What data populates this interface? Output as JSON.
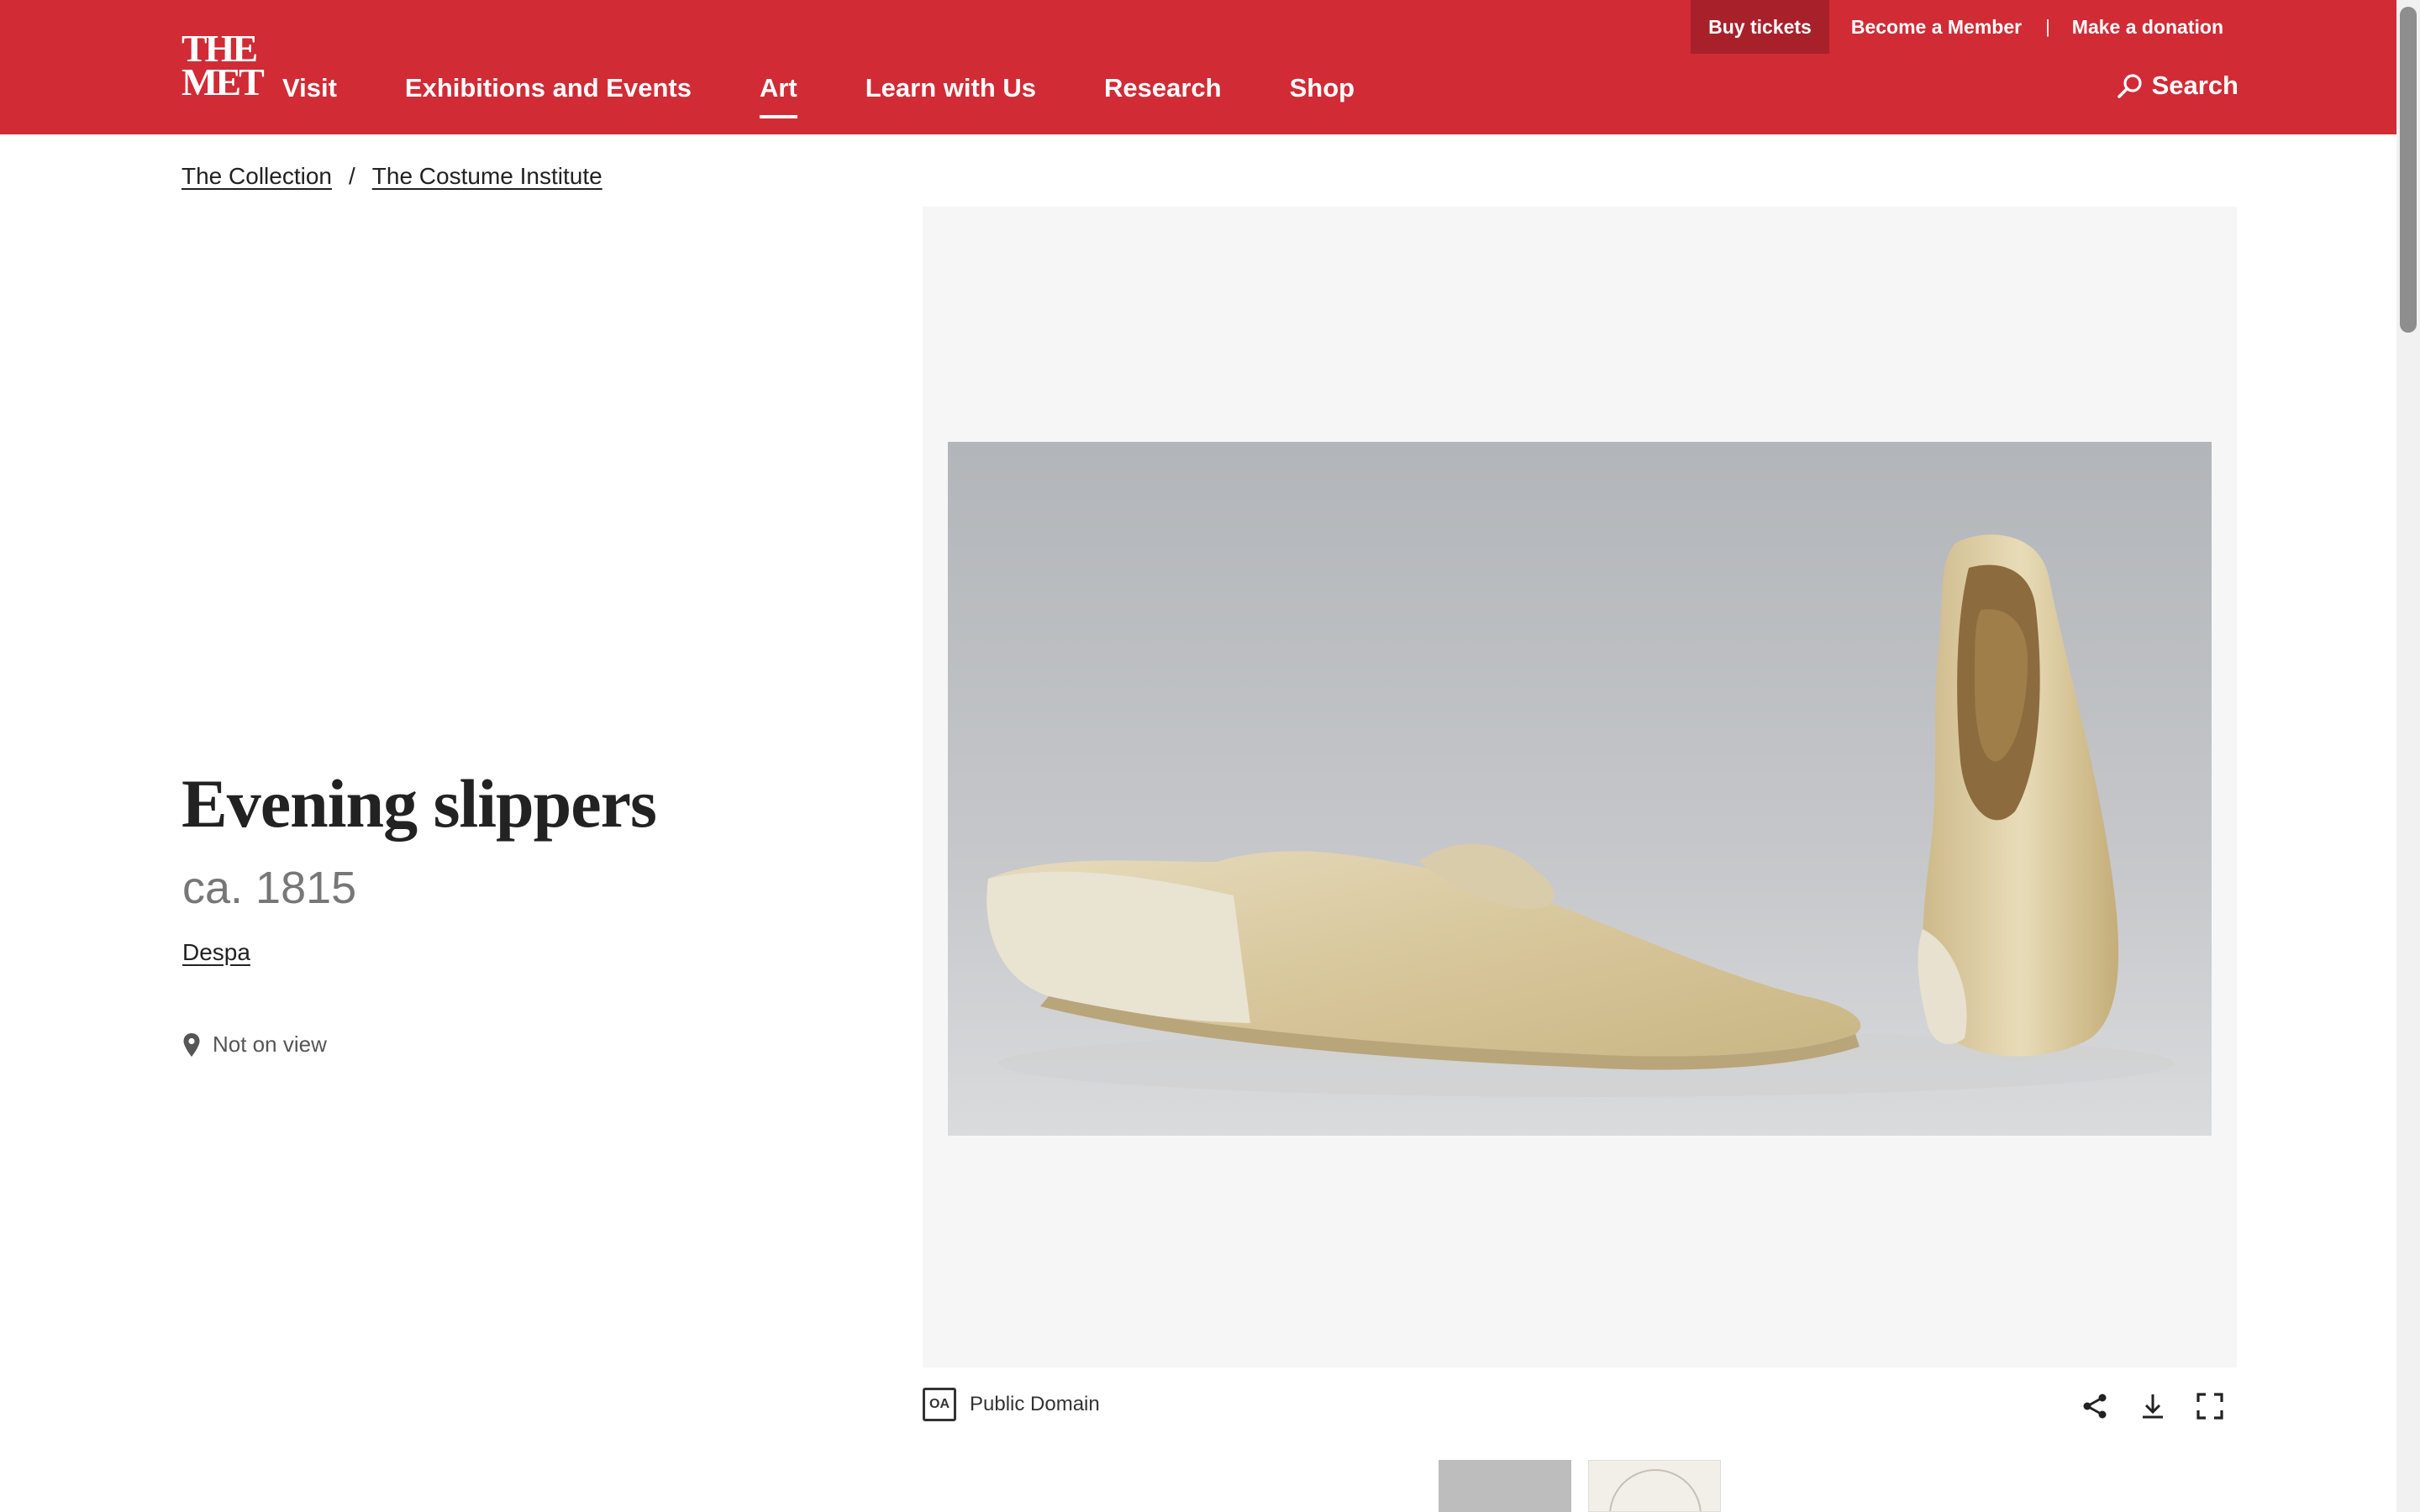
{
  "header": {
    "logo": {
      "line1": "THE",
      "line2": "MET"
    },
    "nav": [
      {
        "label": "Visit",
        "active": false
      },
      {
        "label": "Exhibitions and Events",
        "active": false
      },
      {
        "label": "Art",
        "active": true
      },
      {
        "label": "Learn with Us",
        "active": false
      },
      {
        "label": "Research",
        "active": false
      },
      {
        "label": "Shop",
        "active": false
      }
    ],
    "utility": {
      "buy_tickets": "Buy tickets",
      "become_member": "Become a Member",
      "separator": "|",
      "donation": "Make a donation"
    },
    "search_label": "Search",
    "colors": {
      "brand": "#d12b35",
      "buy_button": "#a8202a"
    }
  },
  "breadcrumb": {
    "items": [
      "The Collection",
      "The Costume Institute"
    ],
    "separator": "/"
  },
  "artwork": {
    "title": "Evening slippers",
    "date": "ca. 1815",
    "maker": "Despa",
    "location_status": "Not on view"
  },
  "viewer": {
    "rights_badge": "OA",
    "rights_label": "Public Domain",
    "tools": [
      "share-icon",
      "download-icon",
      "fullscreen-icon"
    ]
  }
}
